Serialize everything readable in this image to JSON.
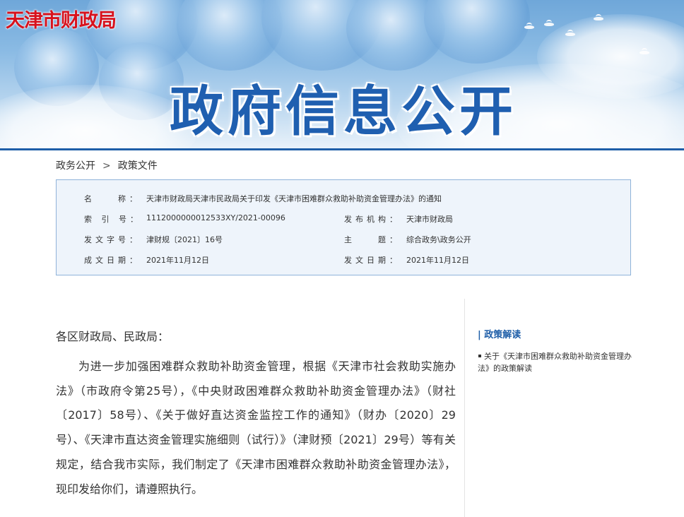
{
  "header": {
    "site_name": "天津市财政局",
    "banner_title": "政府信息公开"
  },
  "breadcrumb": {
    "items": [
      "政务公开",
      "政策文件"
    ],
    "separator": ">"
  },
  "meta": {
    "name_label": "名　　称：",
    "name_value": "天津市财政局天津市民政局关于印发《天津市困难群众救助补助资金管理办法》的通知",
    "index_label": "索 引 号：",
    "index_value": "1112000000012533XY/2021-00096",
    "issuer_label": "发布机构：",
    "issuer_value": "天津市财政局",
    "doc_no_label": "发文字号：",
    "doc_no_value": "津财规〔2021〕16号",
    "topic_label": "主　　题：",
    "topic_value": "综合政务\\政务公开",
    "created_label": "成文日期：",
    "created_value": "2021年11月12日",
    "issued_label": "发文日期：",
    "issued_value": "2021年11月12日"
  },
  "article": {
    "salutation": "各区财政局、民政局：",
    "paragraph": "为进一步加强困难群众救助补助资金管理，根据《天津市社会救助实施办法》（市政府令第25号），《中央财政困难群众救助补助资金管理办法》（财社〔2017〕58号）、《关于做好直达资金监控工作的通知》（财办〔2020〕29号）、《天津市直达资金管理实施细则（试行）》（津财预〔2021〕29号）等有关规定，结合我市实际，我们制定了《天津市困难群众救助补助资金管理办法》，现印发给你们，请遵照执行。"
  },
  "sidebar": {
    "title": "| 政策解读",
    "items": [
      {
        "label": "关于《天津市困难群众救助补助资金管理办法》的政策解读"
      }
    ]
  },
  "colors": {
    "logo_red": "#d7121d",
    "title_blue": "#1f5fb0",
    "accent_blue": "#1e5ea8",
    "meta_bg": "#eef4fb",
    "meta_border": "#8fb3d9"
  }
}
